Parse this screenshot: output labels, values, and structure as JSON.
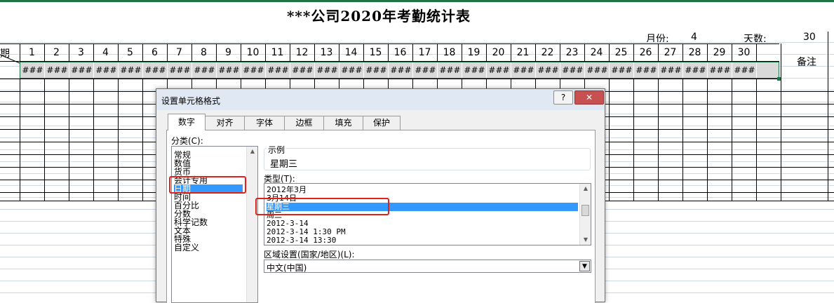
{
  "sheet": {
    "title": "***公司2020年考勤统计表",
    "month_label": "月份:",
    "month_value": "4",
    "days_label": "天数:",
    "days_value": "30",
    "header_fragment": "期",
    "day_numbers": [
      "1",
      "2",
      "3",
      "4",
      "5",
      "6",
      "7",
      "8",
      "9",
      "10",
      "11",
      "12",
      "13",
      "14",
      "15",
      "16",
      "17",
      "18",
      "19",
      "20",
      "21",
      "22",
      "23",
      "24",
      "25",
      "26",
      "27",
      "28",
      "29",
      "30"
    ],
    "overflow_marker": "###",
    "remark_header": "备注"
  },
  "dialog": {
    "title": "设置单元格格式",
    "help_label": "?",
    "close_label": "✕",
    "tabs": [
      "数字",
      "对齐",
      "字体",
      "边框",
      "填充",
      "保护"
    ],
    "active_tab": "数字",
    "category_label": "分类(C):",
    "categories": [
      "常规",
      "数值",
      "货币",
      "会计专用",
      "日期",
      "时间",
      "百分比",
      "分数",
      "科学记数",
      "文本",
      "特殊",
      "自定义"
    ],
    "selected_category": "日期",
    "sample_label": "示例",
    "sample_value": "星期三",
    "type_label": "类型(T):",
    "types": [
      "2012年3月",
      "3月14日",
      "星期三",
      "周三",
      "2012-3-14",
      "2012-3-14 1:30 PM",
      "2012-3-14 13:30"
    ],
    "selected_type": "星期三",
    "locale_label": "区域设置(国家/地区)(L):",
    "locale_value": "中文(中国)"
  },
  "colors": {
    "excel_green": "#217346",
    "selection_blue": "#3399ff",
    "highlight_red": "#e0201b",
    "close_red": "#c75050"
  }
}
